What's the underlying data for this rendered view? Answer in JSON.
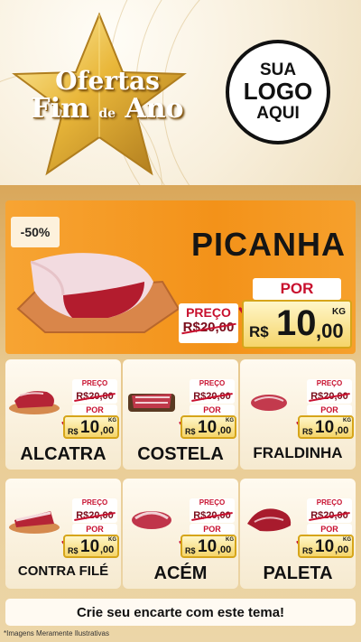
{
  "header": {
    "brand_line1": "Ofertas",
    "brand_line2": "Fim",
    "brand_de": "de",
    "brand_line3": "Ano",
    "logo_line1": "SUA",
    "logo_line2": "LOGO",
    "logo_line3": "AQUI"
  },
  "hero": {
    "discount": "-50%",
    "title": "PICANHA",
    "por_label": "POR",
    "preco_label": "PREÇO",
    "old_price": "R$20,00",
    "currency": "R$",
    "price_int": "10",
    "price_cents": ",00",
    "unit": "KG"
  },
  "cards": [
    {
      "name": "ALCATRA",
      "preco_label": "PREÇO",
      "old_price": "R$20,00",
      "por_label": "POR",
      "currency": "R$",
      "price_int": "10",
      "price_cents": ",00",
      "unit": "KG"
    },
    {
      "name": "COSTELA",
      "preco_label": "PREÇO",
      "old_price": "R$20,00",
      "por_label": "POR",
      "currency": "R$",
      "price_int": "10",
      "price_cents": ",00",
      "unit": "KG"
    },
    {
      "name": "FRALDINHA",
      "preco_label": "PREÇO",
      "old_price": "R$20,00",
      "por_label": "POR",
      "currency": "R$",
      "price_int": "10",
      "price_cents": ",00",
      "unit": "KG"
    },
    {
      "name": "CONTRA FILÉ",
      "preco_label": "PREÇO",
      "old_price": "R$20,00",
      "por_label": "POR",
      "currency": "R$",
      "price_int": "10",
      "price_cents": ",00",
      "unit": "KG"
    },
    {
      "name": "ACÉM",
      "preco_label": "PREÇO",
      "old_price": "R$20,00",
      "por_label": "POR",
      "currency": "R$",
      "price_int": "10",
      "price_cents": ",00",
      "unit": "KG"
    },
    {
      "name": "PALETA",
      "preco_label": "PREÇO",
      "old_price": "R$20,00",
      "por_label": "POR",
      "currency": "R$",
      "price_int": "10",
      "price_cents": ",00",
      "unit": "KG"
    }
  ],
  "cta": "Crie seu encarte com este tema!",
  "footnote": "*Imagens Meramente Ilustrativas",
  "colors": {
    "orange": "#f39219",
    "red": "#c8102e",
    "gold": "#e9b73a"
  },
  "icons": [
    "star-icon",
    "heart-icon"
  ]
}
